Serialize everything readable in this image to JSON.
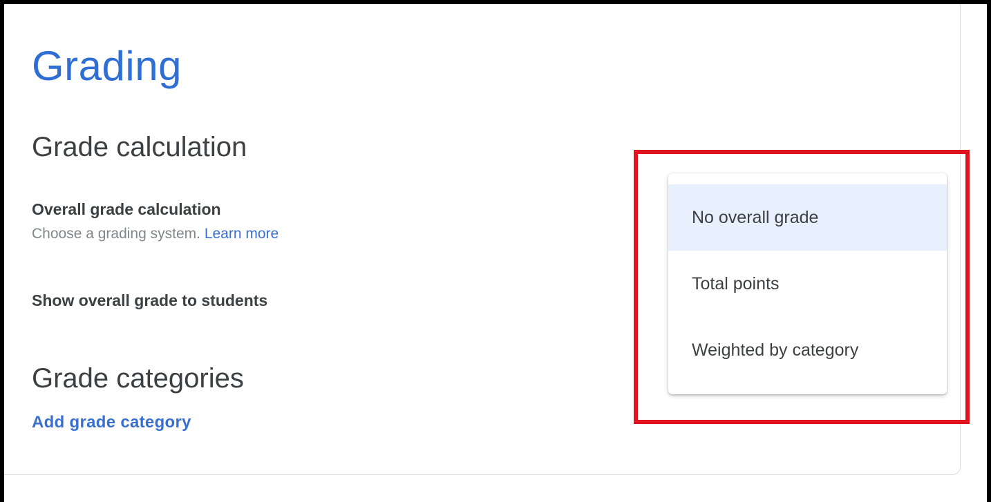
{
  "page": {
    "title": "Grading"
  },
  "grade_calculation": {
    "section_title": "Grade calculation",
    "overall_label": "Overall grade calculation",
    "overall_desc": "Choose a grading system.",
    "learn_more": "Learn more",
    "show_overall_label": "Show overall grade to students"
  },
  "grade_categories": {
    "section_title": "Grade categories",
    "add_label": "Add grade category"
  },
  "dropdown": {
    "selected_index": 0,
    "options": [
      {
        "label": "No overall grade"
      },
      {
        "label": "Total points"
      },
      {
        "label": "Weighted by category"
      }
    ]
  },
  "colors": {
    "accent": "#2f6ed3",
    "link": "#3a6fcf",
    "selected_bg": "#e8f0fe",
    "highlight": "#e0141e",
    "text": "#3c4043",
    "muted": "#80868b"
  }
}
